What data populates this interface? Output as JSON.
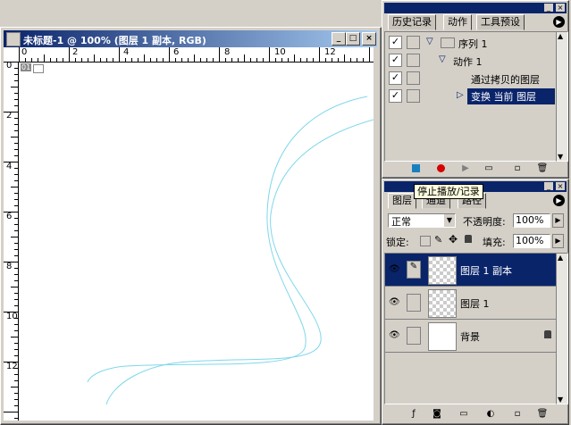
{
  "document": {
    "title": "未标题-1 @ 100% (图层 1 副本, RGB)",
    "ruler_top_labels": [
      "0",
      "2",
      "4",
      "6",
      "8",
      "10",
      "12"
    ],
    "ruler_left_labels": [
      "0",
      "2",
      "4",
      "6",
      "8",
      "10",
      "12"
    ],
    "corner_badge": "01",
    "buttons": {
      "minimize": "_",
      "maximize": "□",
      "close": "×"
    }
  },
  "history_panel": {
    "tabs": [
      "历史记录",
      "动作",
      "工具预设"
    ],
    "active_tab": "动作",
    "rows": [
      {
        "label": "序列 1",
        "checked": true,
        "icon": "folder-icon",
        "expand": "▽"
      },
      {
        "label": "动作 1",
        "checked": true,
        "expand": "▽"
      },
      {
        "label": "通过拷贝的图层",
        "checked": true
      },
      {
        "label": "变换 当前 图层",
        "checked": true,
        "selected": true,
        "expand": "▷"
      }
    ],
    "tooltip": "停止播放/记录"
  },
  "layers_panel": {
    "tabs": [
      "图层",
      "通道",
      "路径"
    ],
    "active_tab": "图层",
    "blend_mode": "正常",
    "opacity_label": "不透明度:",
    "opacity_value": "100%",
    "lock_label": "锁定:",
    "fill_label": "填充:",
    "fill_value": "100%",
    "layers": [
      {
        "name": "图层 1 副本",
        "selected": true,
        "visible": true,
        "thumb": "transparent"
      },
      {
        "name": "图层 1",
        "selected": false,
        "visible": true,
        "thumb": "transparent"
      },
      {
        "name": "背景",
        "selected": false,
        "visible": true,
        "thumb": "white",
        "locked": true
      }
    ]
  },
  "colors": {
    "titlebar": "#0a246a",
    "selection": "#0a246a",
    "stroke": "#7fd7ea",
    "record": "#d60000",
    "stop": "#1a7fbf"
  }
}
